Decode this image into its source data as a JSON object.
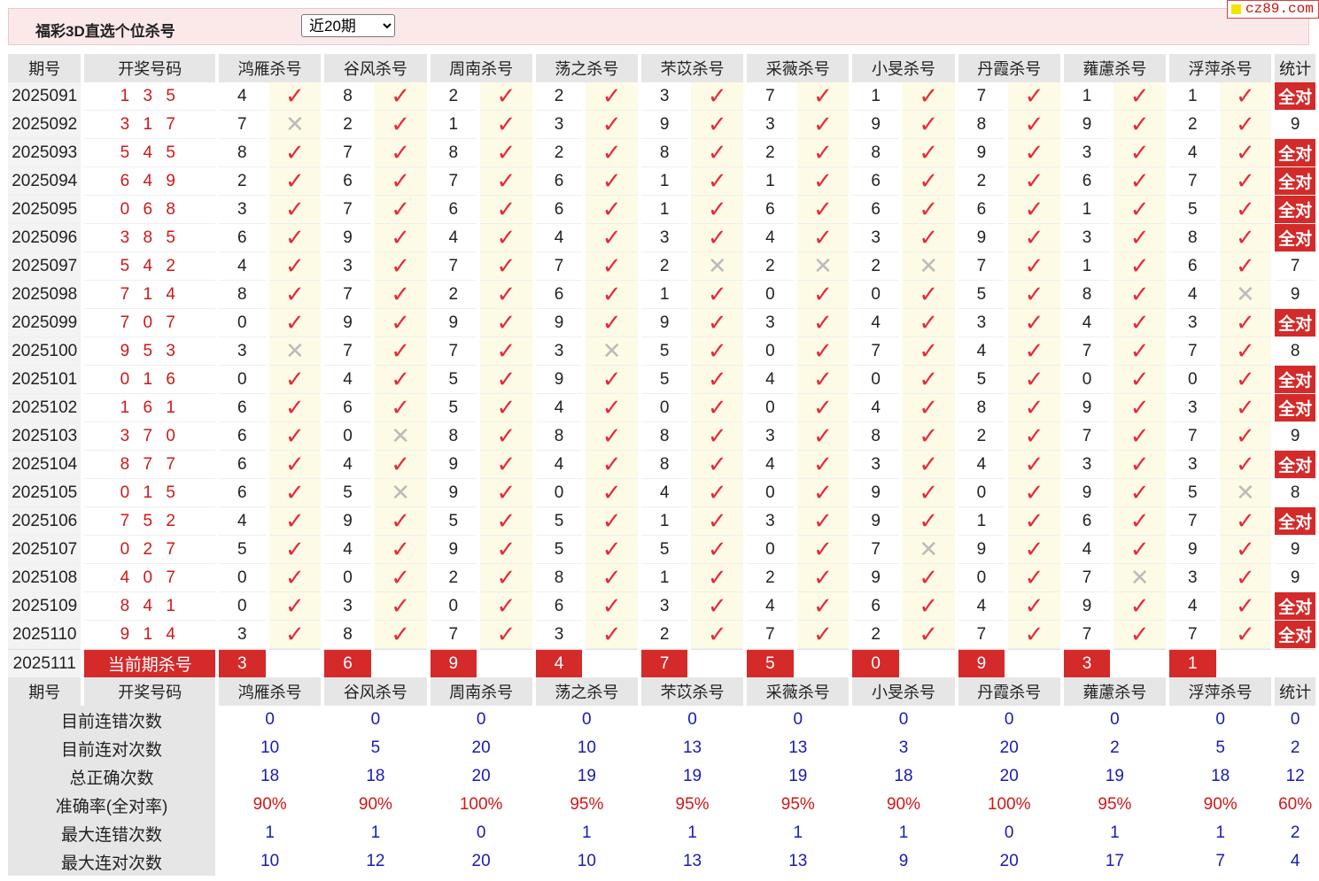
{
  "header": {
    "title": "福彩3D直选个位杀号",
    "period_select": "近20期",
    "brand": "cz89.com"
  },
  "columns": {
    "period": "期号",
    "draw": "开奖号码",
    "experts": [
      "鸿雁杀号",
      "谷风杀号",
      "周南杀号",
      "荡之杀号",
      "芣苡杀号",
      "采薇杀号",
      "小旻杀号",
      "丹霞杀号",
      "蕹藘杀号",
      "浮萍杀号"
    ],
    "stat": "统计"
  },
  "rows": [
    {
      "period": "2025091",
      "draw": "1 3 5",
      "kills": [
        "4",
        "8",
        "2",
        "2",
        "3",
        "7",
        "1",
        "7",
        "1",
        "1"
      ],
      "marks": [
        1,
        1,
        1,
        1,
        1,
        1,
        1,
        1,
        1,
        1
      ],
      "stat": "全对"
    },
    {
      "period": "2025092",
      "draw": "3 1 7",
      "kills": [
        "7",
        "2",
        "1",
        "3",
        "9",
        "3",
        "9",
        "8",
        "9",
        "2"
      ],
      "marks": [
        0,
        1,
        1,
        1,
        1,
        1,
        1,
        1,
        1,
        1
      ],
      "stat": "9"
    },
    {
      "period": "2025093",
      "draw": "5 4 5",
      "kills": [
        "8",
        "7",
        "8",
        "2",
        "8",
        "2",
        "8",
        "9",
        "3",
        "4"
      ],
      "marks": [
        1,
        1,
        1,
        1,
        1,
        1,
        1,
        1,
        1,
        1
      ],
      "stat": "全对"
    },
    {
      "period": "2025094",
      "draw": "6 4 9",
      "kills": [
        "2",
        "6",
        "7",
        "6",
        "1",
        "1",
        "6",
        "2",
        "6",
        "7"
      ],
      "marks": [
        1,
        1,
        1,
        1,
        1,
        1,
        1,
        1,
        1,
        1
      ],
      "stat": "全对"
    },
    {
      "period": "2025095",
      "draw": "0 6 8",
      "kills": [
        "3",
        "7",
        "6",
        "6",
        "1",
        "6",
        "6",
        "6",
        "1",
        "5"
      ],
      "marks": [
        1,
        1,
        1,
        1,
        1,
        1,
        1,
        1,
        1,
        1
      ],
      "stat": "全对"
    },
    {
      "period": "2025096",
      "draw": "3 8 5",
      "kills": [
        "6",
        "9",
        "4",
        "4",
        "3",
        "4",
        "3",
        "9",
        "3",
        "8"
      ],
      "marks": [
        1,
        1,
        1,
        1,
        1,
        1,
        1,
        1,
        1,
        1
      ],
      "stat": "全对"
    },
    {
      "period": "2025097",
      "draw": "5 4 2",
      "kills": [
        "4",
        "3",
        "7",
        "7",
        "2",
        "2",
        "2",
        "7",
        "1",
        "6"
      ],
      "marks": [
        1,
        1,
        1,
        1,
        0,
        0,
        0,
        1,
        1,
        1
      ],
      "stat": "7"
    },
    {
      "period": "2025098",
      "draw": "7 1 4",
      "kills": [
        "8",
        "7",
        "2",
        "6",
        "1",
        "0",
        "0",
        "5",
        "8",
        "4"
      ],
      "marks": [
        1,
        1,
        1,
        1,
        1,
        1,
        1,
        1,
        1,
        0
      ],
      "stat": "9"
    },
    {
      "period": "2025099",
      "draw": "7 0 7",
      "kills": [
        "0",
        "9",
        "9",
        "9",
        "9",
        "3",
        "4",
        "3",
        "4",
        "3"
      ],
      "marks": [
        1,
        1,
        1,
        1,
        1,
        1,
        1,
        1,
        1,
        1
      ],
      "stat": "全对"
    },
    {
      "period": "2025100",
      "draw": "9 5 3",
      "kills": [
        "3",
        "7",
        "7",
        "3",
        "5",
        "0",
        "7",
        "4",
        "7",
        "7"
      ],
      "marks": [
        0,
        1,
        1,
        0,
        1,
        1,
        1,
        1,
        1,
        1
      ],
      "stat": "8"
    },
    {
      "period": "2025101",
      "draw": "0 1 6",
      "kills": [
        "0",
        "4",
        "5",
        "9",
        "5",
        "4",
        "0",
        "5",
        "0",
        "0"
      ],
      "marks": [
        1,
        1,
        1,
        1,
        1,
        1,
        1,
        1,
        1,
        1
      ],
      "stat": "全对"
    },
    {
      "period": "2025102",
      "draw": "1 6 1",
      "kills": [
        "6",
        "6",
        "5",
        "4",
        "0",
        "0",
        "4",
        "8",
        "9",
        "3"
      ],
      "marks": [
        1,
        1,
        1,
        1,
        1,
        1,
        1,
        1,
        1,
        1
      ],
      "stat": "全对"
    },
    {
      "period": "2025103",
      "draw": "3 7 0",
      "kills": [
        "6",
        "0",
        "8",
        "8",
        "8",
        "3",
        "8",
        "2",
        "7",
        "7"
      ],
      "marks": [
        1,
        0,
        1,
        1,
        1,
        1,
        1,
        1,
        1,
        1
      ],
      "stat": "9"
    },
    {
      "period": "2025104",
      "draw": "8 7 7",
      "kills": [
        "6",
        "4",
        "9",
        "4",
        "8",
        "4",
        "3",
        "4",
        "3",
        "3"
      ],
      "marks": [
        1,
        1,
        1,
        1,
        1,
        1,
        1,
        1,
        1,
        1
      ],
      "stat": "全对"
    },
    {
      "period": "2025105",
      "draw": "0 1 5",
      "kills": [
        "6",
        "5",
        "9",
        "0",
        "4",
        "0",
        "9",
        "0",
        "9",
        "5"
      ],
      "marks": [
        1,
        0,
        1,
        1,
        1,
        1,
        1,
        1,
        1,
        0
      ],
      "stat": "8"
    },
    {
      "period": "2025106",
      "draw": "7 5 2",
      "kills": [
        "4",
        "9",
        "5",
        "5",
        "1",
        "3",
        "9",
        "1",
        "6",
        "7"
      ],
      "marks": [
        1,
        1,
        1,
        1,
        1,
        1,
        1,
        1,
        1,
        1
      ],
      "stat": "全对"
    },
    {
      "period": "2025107",
      "draw": "0 2 7",
      "kills": [
        "5",
        "4",
        "9",
        "5",
        "5",
        "0",
        "7",
        "9",
        "4",
        "9"
      ],
      "marks": [
        1,
        1,
        1,
        1,
        1,
        1,
        0,
        1,
        1,
        1
      ],
      "stat": "9"
    },
    {
      "period": "2025108",
      "draw": "4 0 7",
      "kills": [
        "0",
        "0",
        "2",
        "8",
        "1",
        "2",
        "9",
        "0",
        "7",
        "3"
      ],
      "marks": [
        1,
        1,
        1,
        1,
        1,
        1,
        1,
        1,
        0,
        1
      ],
      "stat": "9"
    },
    {
      "period": "2025109",
      "draw": "8 4 1",
      "kills": [
        "0",
        "3",
        "0",
        "6",
        "3",
        "4",
        "6",
        "4",
        "9",
        "4"
      ],
      "marks": [
        1,
        1,
        1,
        1,
        1,
        1,
        1,
        1,
        1,
        1
      ],
      "stat": "全对"
    },
    {
      "period": "2025110",
      "draw": "9 1 4",
      "kills": [
        "3",
        "8",
        "7",
        "3",
        "2",
        "7",
        "2",
        "7",
        "7",
        "7"
      ],
      "marks": [
        1,
        1,
        1,
        1,
        1,
        1,
        1,
        1,
        1,
        1
      ],
      "stat": "全对"
    }
  ],
  "current": {
    "period": "2025111",
    "label": "当前期杀号",
    "kills": [
      "3",
      "6",
      "9",
      "4",
      "7",
      "5",
      "0",
      "9",
      "3",
      "1"
    ]
  },
  "summary": [
    {
      "label": "目前连错次数",
      "values": [
        "0",
        "0",
        "0",
        "0",
        "0",
        "0",
        "0",
        "0",
        "0",
        "0"
      ],
      "stat": "0",
      "red": false
    },
    {
      "label": "目前连对次数",
      "values": [
        "10",
        "5",
        "20",
        "10",
        "13",
        "13",
        "3",
        "20",
        "2",
        "5"
      ],
      "stat": "2",
      "red": false
    },
    {
      "label": "总正确次数",
      "values": [
        "18",
        "18",
        "20",
        "19",
        "19",
        "19",
        "18",
        "20",
        "19",
        "18"
      ],
      "stat": "12",
      "red": false
    },
    {
      "label": "准确率(全对率)",
      "values": [
        "90%",
        "90%",
        "100%",
        "95%",
        "95%",
        "95%",
        "90%",
        "100%",
        "95%",
        "90%"
      ],
      "stat": "60%",
      "red": true
    },
    {
      "label": "最大连错次数",
      "values": [
        "1",
        "1",
        "0",
        "1",
        "1",
        "1",
        "1",
        "0",
        "1",
        "1"
      ],
      "stat": "2",
      "red": false
    },
    {
      "label": "最大连对次数",
      "values": [
        "10",
        "12",
        "20",
        "10",
        "13",
        "13",
        "9",
        "20",
        "17",
        "7"
      ],
      "stat": "4",
      "red": false
    }
  ],
  "symbols": {
    "check": "✓",
    "cross": "✕"
  },
  "colors": {
    "accent_red": "#d42a2a",
    "value_blue": "#1a1ab4",
    "check_red": "#e8283d"
  }
}
